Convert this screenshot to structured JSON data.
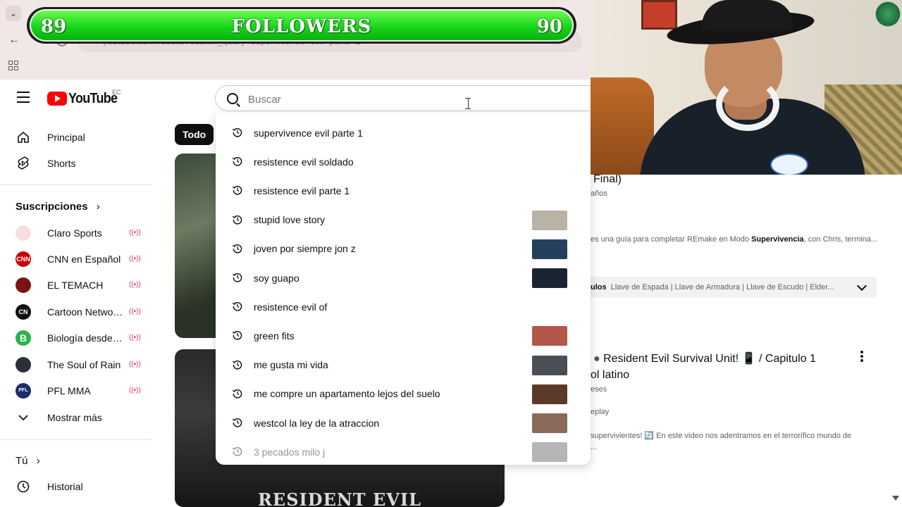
{
  "browser": {
    "url": "youtube.com/results?search_query=supervivence+evil+parte+1"
  },
  "overlay": {
    "title": "FOLLOWERS",
    "left_count": "89",
    "right_count": "90"
  },
  "header": {
    "logo_text": "YouTube",
    "region": "EC",
    "search_placeholder": "Buscar"
  },
  "sidebar": {
    "main": [
      {
        "label": "Principal",
        "icon": "home-icon"
      },
      {
        "label": "Shorts",
        "icon": "shorts-icon"
      }
    ],
    "subscriptions_title": "Suscripciones",
    "subscriptions": [
      {
        "label": "Claro Sports",
        "avatar": "",
        "color": "#f7dede",
        "live": "((•))"
      },
      {
        "label": "CNN en Español",
        "avatar": "CNN",
        "color": "#cc0000",
        "live": "((•))"
      },
      {
        "label": "EL TEMACH",
        "avatar": "",
        "color": "#7a1414",
        "live": "((•))"
      },
      {
        "label": "Cartoon Network…",
        "avatar": "CN",
        "color": "#111111",
        "live": "((•))"
      },
      {
        "label": "Biología desde c…",
        "avatar": "B",
        "color": "#2bb24c",
        "live": "((•))"
      },
      {
        "label": "The Soul of Rain",
        "avatar": "",
        "color": "#2b2f3a",
        "live": "((•))"
      },
      {
        "label": "PFL MMA",
        "avatar": "PFL",
        "color": "#1b2b6b",
        "live": "((•))"
      }
    ],
    "show_more": "Mostrar más",
    "you_title": "Tú",
    "history": "Historial"
  },
  "chips": {
    "all": "Todo"
  },
  "suggestions": [
    {
      "text": "supervivence evil parte 1",
      "thumb": ""
    },
    {
      "text": "resistence evil soldado",
      "thumb": ""
    },
    {
      "text": "resistence evil parte 1",
      "thumb": ""
    },
    {
      "text": "stupid love story",
      "thumb": "#b8b3a6"
    },
    {
      "text": "joven por siempre jon z",
      "thumb": "#24405c"
    },
    {
      "text": "soy guapo",
      "thumb": "#1a2430"
    },
    {
      "text": "resistence evil of",
      "thumb": ""
    },
    {
      "text": "green fits",
      "thumb": "#b3574a"
    },
    {
      "text": "me gusta mi vida",
      "thumb": "#4a4f55"
    },
    {
      "text": "me compre un apartamento lejos del suelo",
      "thumb": "#5b3a2a"
    },
    {
      "text": "westcol la ley de la atraccion",
      "thumb": "#8a6a5a"
    },
    {
      "text": "3 pecados milo j",
      "thumb": "#5a5a5a"
    }
  ],
  "results": {
    "r1_title_tail": "Final)",
    "r1_meta": "años",
    "r1_desc_pre": "es una guía para completar REmake en Modo ",
    "r1_desc_bold": "Supervivencia",
    "r1_desc_post": ", con Chris, termina...",
    "r1_chapters_bold": "ulos",
    "r1_chapters": "Llave de Espada | Llave de Armadura | Llave de Escudo | Elder...",
    "r2_title": "Resident Evil Survival Unit! 📱 / Capitulo 1",
    "r2_title2": "ol latino",
    "r2_meta": "eses",
    "r2_channel": "eplay",
    "r2_desc": "supervivientes! 🔄 En este video nos adentramos en el terrorífico mundo de",
    "r2_desc2": "...",
    "thumb2_text": "RESIDENT EVIL"
  }
}
